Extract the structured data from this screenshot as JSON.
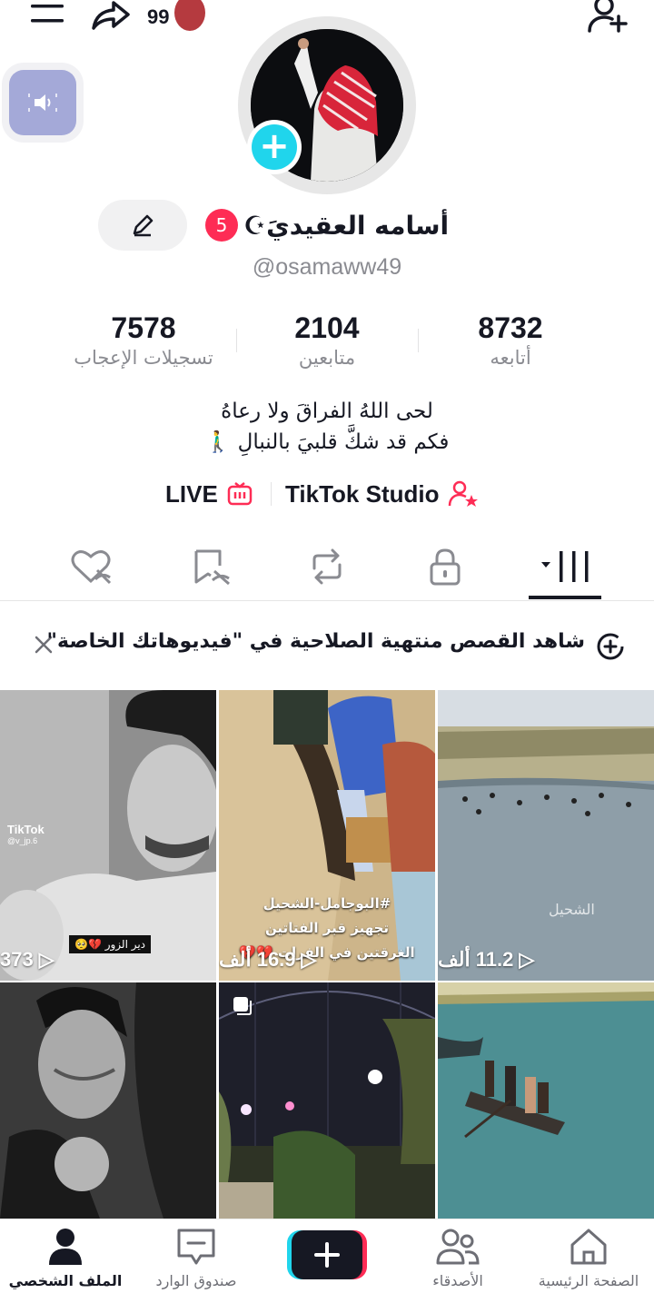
{
  "topbar": {
    "notification_count": "99",
    "icons": [
      "menu-icon",
      "share-icon",
      "add-friend-icon"
    ]
  },
  "profile": {
    "display_name": "أسامه العقيديَ☪︎",
    "badge_count": "5",
    "username": "@osamaww49"
  },
  "stats": [
    {
      "value": "8732",
      "label": "أتابعه"
    },
    {
      "value": "2104",
      "label": "متابعين"
    },
    {
      "value": "7578",
      "label": "تسجيلات الإعجاب"
    }
  ],
  "bio": {
    "line1": "لحى اللهُ الفراقَ ولا رعاهُ",
    "line2": "فكم قد شكَّ قلبيَ بالنبالِ 🚶‍♂️"
  },
  "links": {
    "live": "LIVE",
    "studio": "TikTok Studio"
  },
  "tabs": [
    "videos-grid",
    "private",
    "reposts",
    "favorites",
    "liked"
  ],
  "notice": {
    "text": "شاهد القصص منتهية الصلاحية في \"فيديوهاتك الخاصة\""
  },
  "videos": [
    {
      "views": "11.2 ألف"
    },
    {
      "views": "16.9 ألف",
      "caption_1": "#البوجامل-الشحيل",
      "caption_2": "تجهيز قبر الفتاتين",
      "caption_3": "الغرقتين في الفرات 💔💔"
    },
    {
      "views": "373",
      "tag": "دير الزور 💔🥺",
      "watermark": "TikTok",
      "watermark_user": "@v_jp.6"
    },
    {
      "views": ""
    },
    {
      "views": ""
    },
    {
      "views": ""
    }
  ],
  "video_overlay_text": "الشحيل",
  "bottom_nav": [
    {
      "label": "الصفحة الرئيسية"
    },
    {
      "label": "الأصدقاء"
    },
    {
      "label": ""
    },
    {
      "label": "صندوق الوارد"
    },
    {
      "label": "الملف الشخصي"
    }
  ],
  "colors": {
    "accent": "#fe2c55",
    "cyan": "#20d5ec",
    "text": "#161823",
    "muted": "#8a8b91"
  }
}
